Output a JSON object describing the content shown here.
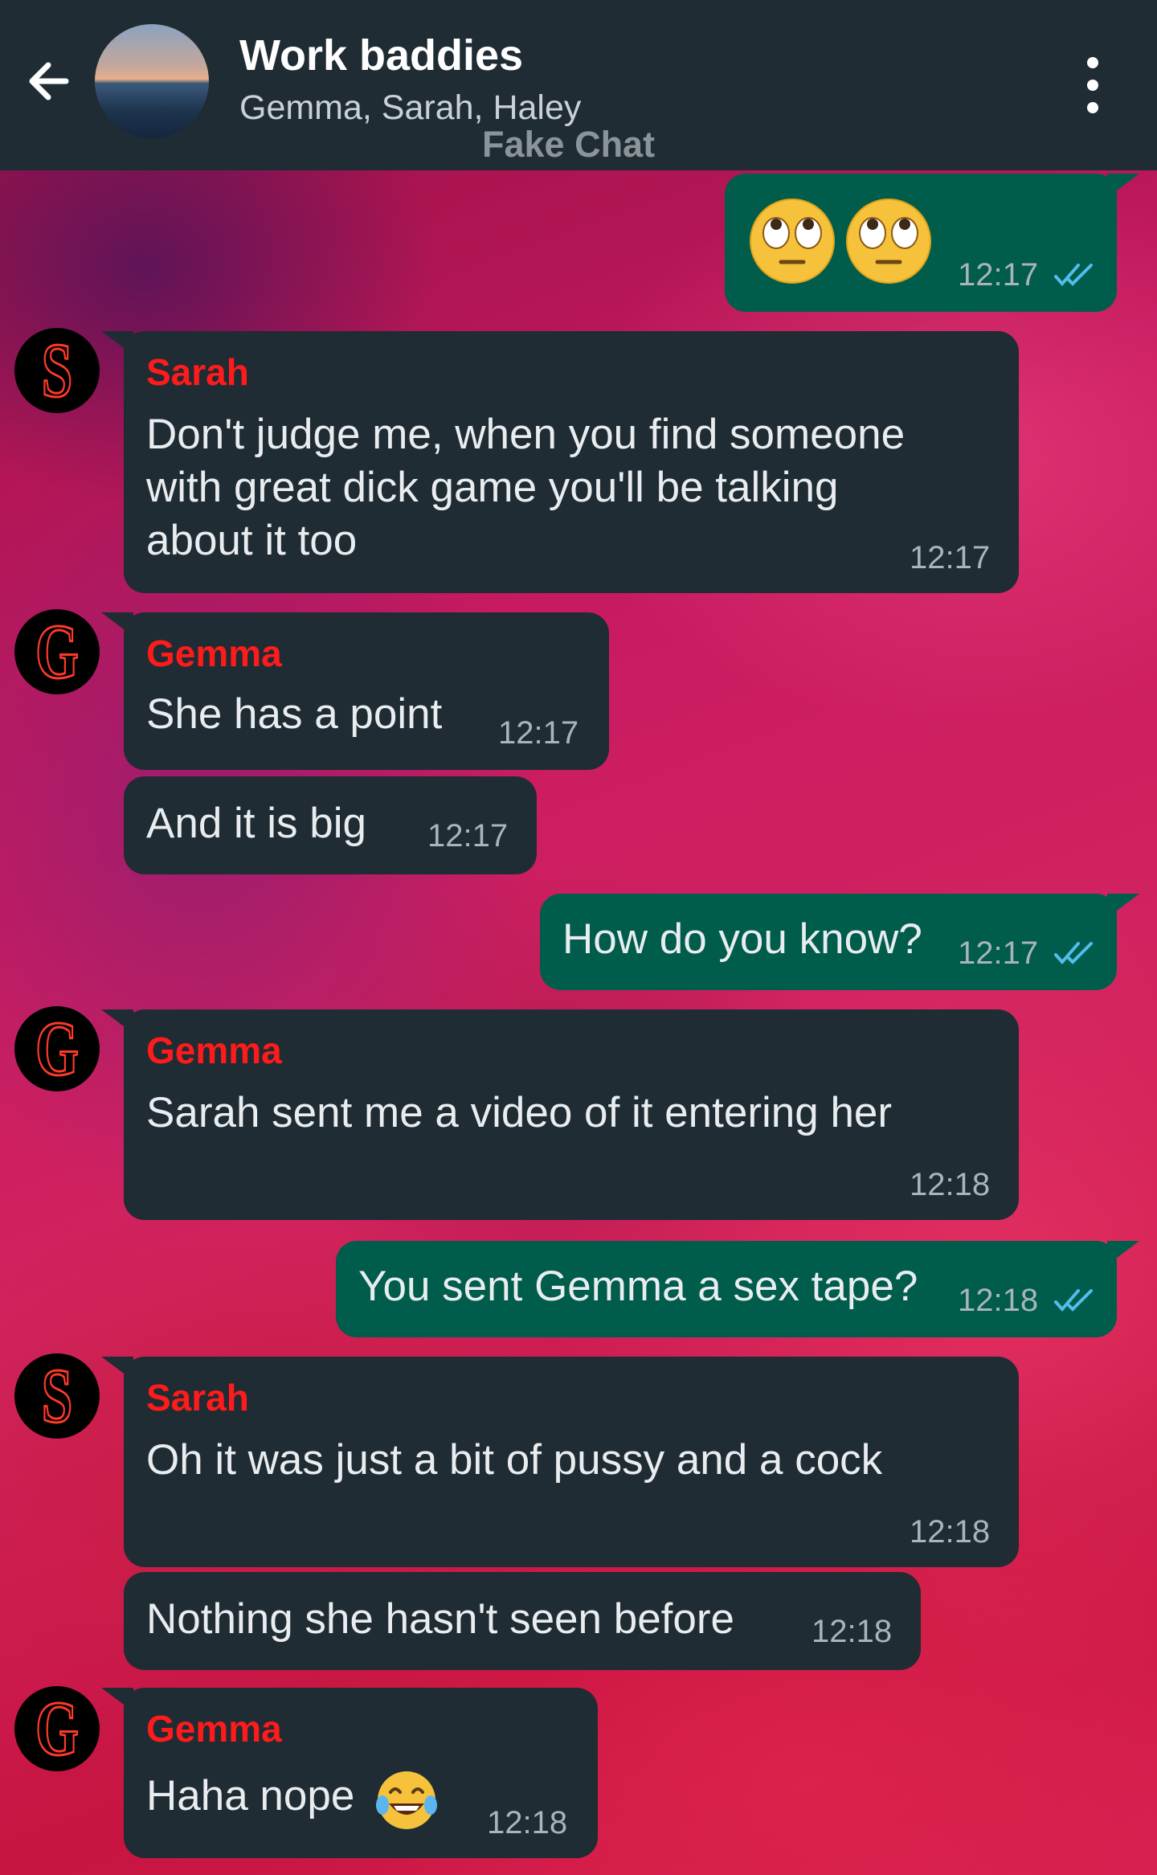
{
  "header": {
    "title": "Work baddies",
    "subtitle": "Gemma, Sarah, Haley",
    "watermark": "Fake Chat"
  },
  "messages": [
    {
      "from": "me",
      "emoji": [
        "face-with-rolling-eyes",
        "face-with-rolling-eyes"
      ],
      "time": "12:17",
      "status": "read"
    },
    {
      "from": "Sarah",
      "sender": "Sarah",
      "avatar_letter": "S",
      "text": "Don't judge me, when you find someone\nwith great dick game you'll be talking\nabout it too",
      "time": "12:17"
    },
    {
      "from": "Gemma",
      "sender": "Gemma",
      "avatar_letter": "G",
      "text": "She has a point",
      "time": "12:17"
    },
    {
      "from": "Gemma",
      "text": "And it is big",
      "time": "12:17"
    },
    {
      "from": "me",
      "text": "How do you know?",
      "time": "12:17",
      "status": "read"
    },
    {
      "from": "Gemma",
      "sender": "Gemma",
      "avatar_letter": "G",
      "text": "Sarah sent me a video of it entering her",
      "time": "12:18"
    },
    {
      "from": "me",
      "text": "You sent Gemma a sex tape?",
      "time": "12:18",
      "status": "read"
    },
    {
      "from": "Sarah",
      "sender": "Sarah",
      "avatar_letter": "S",
      "text": "Oh it was just a bit of pussy and a cock",
      "time": "12:18"
    },
    {
      "from": "Sarah",
      "text": "Nothing she hasn't seen before",
      "time": "12:18"
    },
    {
      "from": "Gemma",
      "sender": "Gemma",
      "avatar_letter": "G",
      "text": "Haha nope",
      "emoji": [
        "face-with-tears-of-joy"
      ],
      "time": "12:18"
    }
  ],
  "colors": {
    "header_bg": "#202c33",
    "incoming_bubble": "#202c33",
    "outgoing_bubble": "#005c4b",
    "sender_name": "#ff1b1b",
    "read_ticks": "#53bdeb"
  }
}
